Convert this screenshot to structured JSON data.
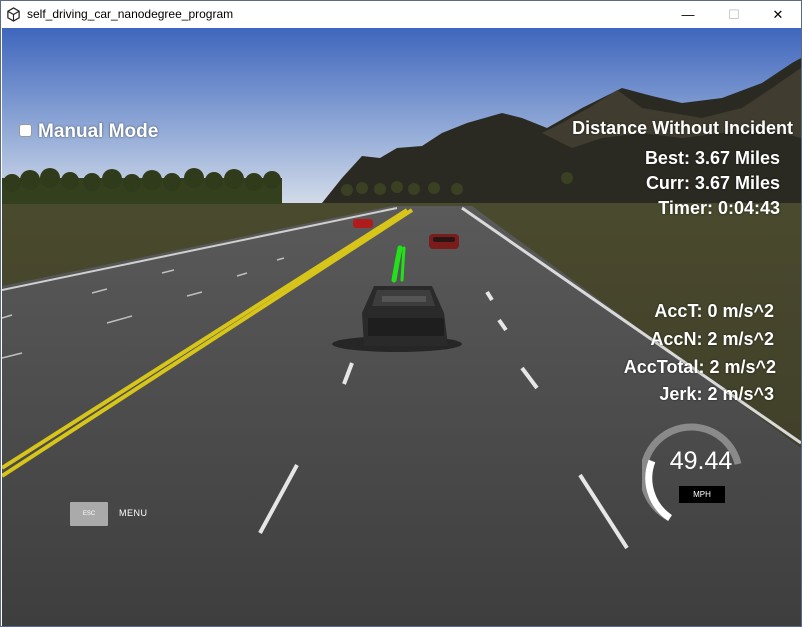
{
  "window": {
    "title": "self_driving_car_nanodegree_program",
    "minimize_glyph": "—",
    "maximize_glyph": "☐",
    "close_glyph": "✕",
    "app_icon": "unity-icon"
  },
  "hud": {
    "manual_mode": {
      "label": "Manual Mode",
      "checked": false
    },
    "distance_title": "Distance Without Incident",
    "best": "Best: 3.67 Miles",
    "curr": "Curr: 3.67 Miles",
    "timer": "Timer: 0:04:43",
    "acc_t": "AccT: 0 m/s^2",
    "acc_n": "AccN: 2 m/s^2",
    "acc_total": "AccTotal: 2 m/s^2",
    "jerk": "Jerk: 2 m/s^3",
    "speed": "49.44",
    "speed_unit": "MPH",
    "esc_key": "ESC",
    "menu_label": "MENU"
  },
  "colors": {
    "sky_top": "#4a6fc0",
    "sky_bottom": "#c9d6ea",
    "road": "#4b4b4b",
    "yellow_line": "#d8c51a",
    "path_green": "#22e01a",
    "lead_car": "#b01c1c"
  }
}
